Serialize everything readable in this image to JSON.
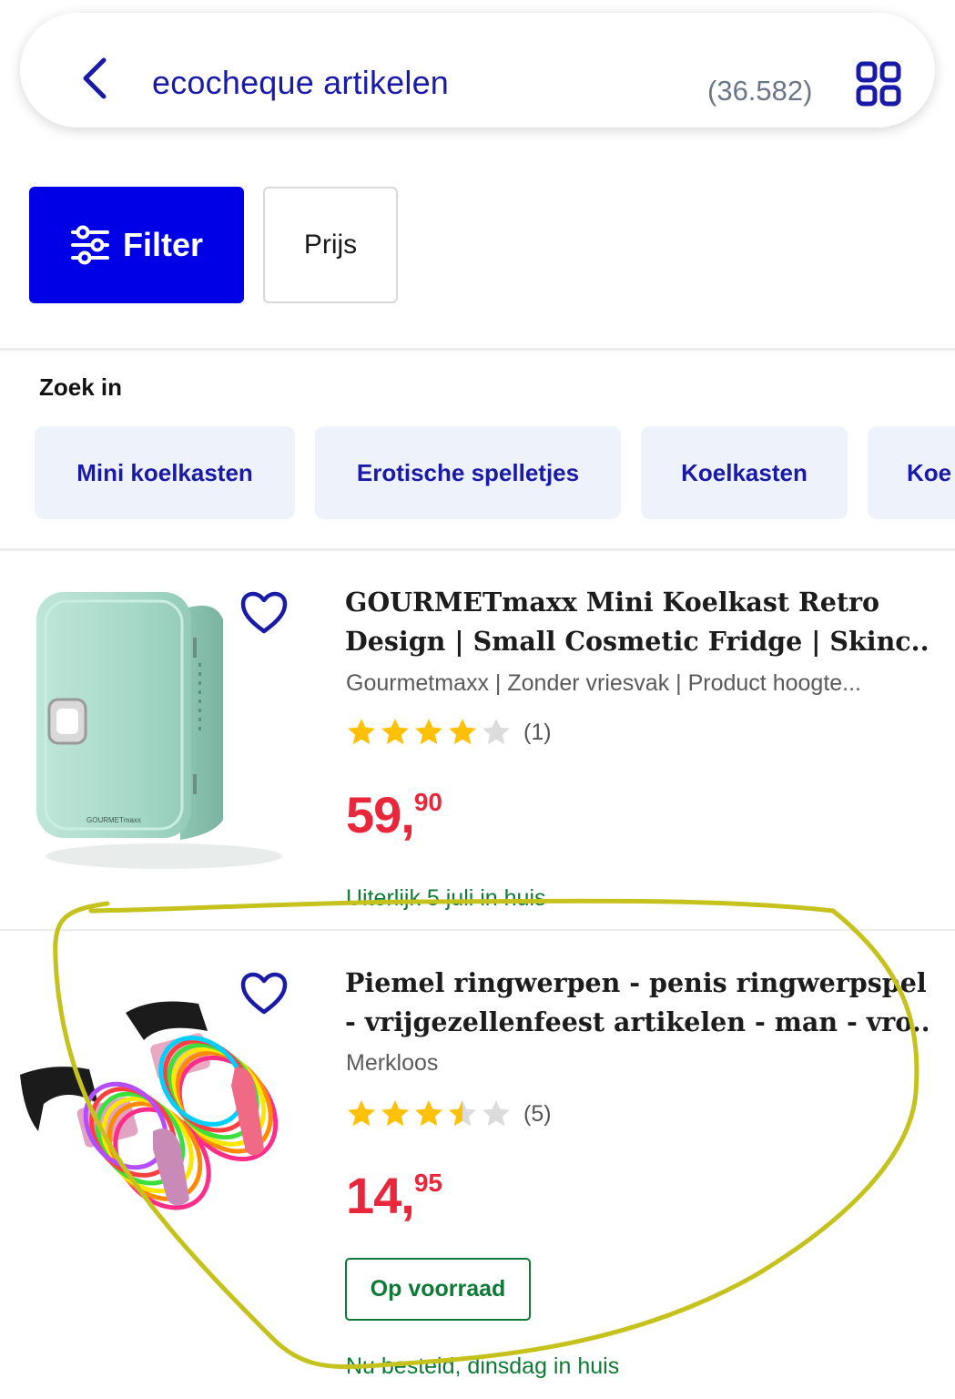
{
  "search": {
    "query": "ecocheque artikelen",
    "result_count": "(36.582)"
  },
  "filters": {
    "filter_label": "Filter",
    "price_label": "Prijs"
  },
  "zoek_in": {
    "title": "Zoek in",
    "chips": [
      "Mini koelkasten",
      "Erotische spelletjes",
      "Koelkasten",
      "Koe"
    ]
  },
  "products": [
    {
      "title_line1": "GOURMETmaxx Mini Koelkast Retro",
      "title_line2": "Design | Small Cosmetic Fridge | Skinc...",
      "subtitle": "Gourmetmaxx | Zonder vriesvak | Product hoogte...",
      "rating": 4,
      "review_count": "(1)",
      "price_whole": "59,",
      "price_cents": "90",
      "delivery": "Uiterlijk 5 juli in huis",
      "image_brand_text": "GOURMETmaxx"
    },
    {
      "title_line1": "Piemel ringwerpen -  penis ringwerpspel",
      "title_line2": "- vrijgezellenfeest artikelen - man - vro...",
      "subtitle": "Merkloos",
      "rating": 3.5,
      "review_count": "(5)",
      "price_whole": "14,",
      "price_cents": "95",
      "stock": "Op voorraad",
      "delivery": "Nu besteld, dinsdag in huis"
    }
  ],
  "colors": {
    "brand_blue": "#0000e6",
    "link_blue": "#1a1aa8",
    "price_red": "#e8273b",
    "stock_green": "#0e7a36",
    "star_yellow": "#ffc107",
    "annotation": "#c6c21d"
  }
}
